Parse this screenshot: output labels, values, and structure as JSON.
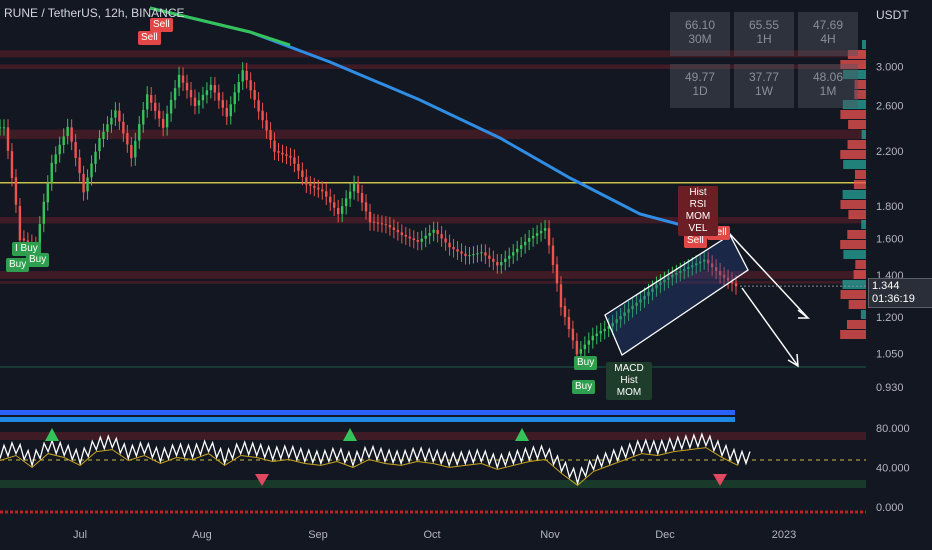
{
  "header": {
    "symbol": "RUNE / TetherUS, 12h, BINANCE",
    "currency": "USDT"
  },
  "stats": [
    {
      "value": "66.10",
      "label": "30M"
    },
    {
      "value": "65.55",
      "label": "1H"
    },
    {
      "value": "47.69",
      "label": "4H"
    },
    {
      "value": "49.77",
      "label": "1D"
    },
    {
      "value": "37.77",
      "label": "1W"
    },
    {
      "value": "48.06",
      "label": "1M"
    }
  ],
  "price_box": {
    "price": "1.344",
    "countdown": "01:36:19"
  },
  "signals": {
    "buy": "Buy",
    "sell": "Sell",
    "ibuy": "I Buy",
    "buy_combo": "Buy",
    "sell_combo_lines": [
      "Hist",
      "RSI",
      "MOM",
      "VEL"
    ],
    "buy_combo_lines": [
      "MACD",
      "Hist",
      "MOM"
    ]
  },
  "colors": {
    "background": "#131722",
    "up": "#26a69a",
    "down": "#ef5350",
    "ma_green": "#36c25a",
    "ma_blue": "#2f8de4",
    "yellow_line": "#c8c24a"
  },
  "chart_data": [
    {
      "type": "candlestick",
      "title": "RUNE / TetherUS, 12h, BINANCE",
      "x_ticks": [
        "Jul",
        "Aug",
        "Sep",
        "Oct",
        "Nov",
        "Dec",
        "2023"
      ],
      "y_ticks": [
        3.0,
        2.6,
        2.2,
        1.8,
        1.6,
        1.4,
        1.2,
        1.05,
        0.93
      ],
      "y_scale": "log",
      "ylim": [
        0.88,
        3.45
      ],
      "last_price": 1.344,
      "horizontal_level": 1.96,
      "series": [
        {
          "x": [
            "Jun 20",
            "Jun 23",
            "Jun 27",
            "Jul 1",
            "Jul 5",
            "Jul 9",
            "Jul 13",
            "Jul 17",
            "Jul 21",
            "Jul 25",
            "Jul 29",
            "Aug 2",
            "Aug 6",
            "Aug 10",
            "Aug 14",
            "Aug 18",
            "Aug 22",
            "Aug 26",
            "Aug 30",
            "Sep 3",
            "Sep 7",
            "Sep 11",
            "Sep 15",
            "Sep 19",
            "Sep 23",
            "Sep 27",
            "Oct 1",
            "Oct 5",
            "Oct 9",
            "Oct 13",
            "Oct 17",
            "Oct 21",
            "Oct 25",
            "Oct 29",
            "Nov 2",
            "Nov 6",
            "Nov 10",
            "Nov 14",
            "Nov 18",
            "Nov 22",
            "Nov 26",
            "Nov 30",
            "Dec 4",
            "Dec 8",
            "Dec 12",
            "Dec 16",
            "Dec 19"
          ],
          "close": [
            2.4,
            1.6,
            1.55,
            2.1,
            2.4,
            1.9,
            2.3,
            2.55,
            2.15,
            2.7,
            2.4,
            2.9,
            2.6,
            2.8,
            2.5,
            2.95,
            2.55,
            2.2,
            2.15,
            1.95,
            1.9,
            1.75,
            1.95,
            1.7,
            1.68,
            1.62,
            1.58,
            1.65,
            1.55,
            1.5,
            1.52,
            1.45,
            1.52,
            1.6,
            1.66,
            1.25,
            1.05,
            1.12,
            1.16,
            1.22,
            1.28,
            1.35,
            1.4,
            1.44,
            1.48,
            1.4,
            1.344
          ]
        }
      ]
    },
    {
      "type": "line",
      "title": "",
      "y_ticks": [
        80,
        40,
        0
      ],
      "ylim": [
        -5,
        100
      ],
      "series": [
        {
          "name": "",
          "values": [
            55,
            60,
            48,
            62,
            58,
            50,
            64,
            66,
            55,
            60,
            52,
            58,
            56,
            62,
            50,
            60,
            58,
            54,
            56,
            52,
            50,
            54,
            48,
            56,
            52,
            50,
            54,
            52,
            48,
            50,
            52,
            46,
            50,
            54,
            56,
            42,
            30,
            44,
            50,
            56,
            62,
            60,
            64,
            66,
            68,
            58,
            50
          ]
        }
      ]
    }
  ]
}
